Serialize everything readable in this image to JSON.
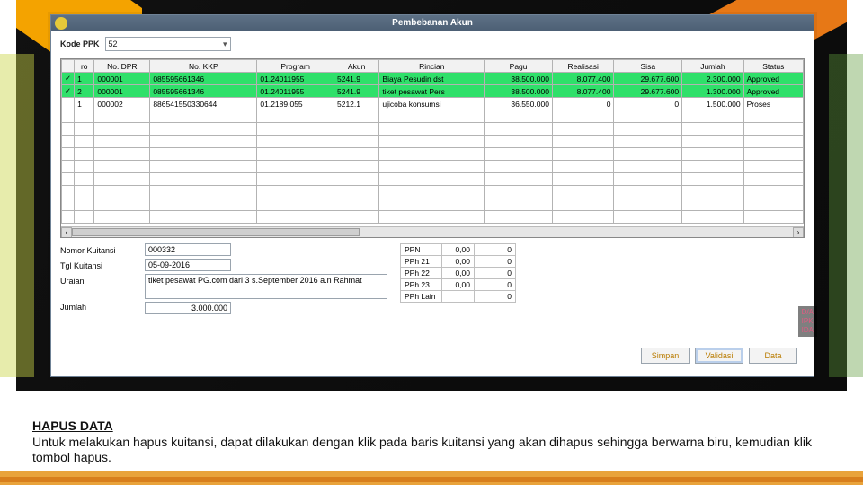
{
  "window": {
    "title": "Pembebanan Akun",
    "kode_ppk_label": "Kode PPK",
    "kode_ppk_value": "52"
  },
  "grid": {
    "headers": [
      "",
      "ro",
      "No. DPR",
      "No. KKP",
      "Program",
      "Akun",
      "Rincian",
      "Pagu",
      "Realisasi",
      "Sisa",
      "Jumlah",
      "Status"
    ],
    "rows": [
      {
        "hl": true,
        "cb": "✓",
        "ro": "1",
        "dpr": "000001",
        "kkp": "085595661346",
        "prog": "01.24011955",
        "akun": "5241.9",
        "rincian": "Biaya Pesudin dst",
        "pagu": "38.500.000",
        "real": "8.077.400",
        "sisa": "29.677.600",
        "jumlah": "2.300.000",
        "status": "Approved"
      },
      {
        "hl": true,
        "cb": "✓",
        "ro": "2",
        "dpr": "000001",
        "kkp": "085595661346",
        "prog": "01.24011955",
        "akun": "5241.9",
        "rincian": "tiket pesawat Pers",
        "pagu": "38.500.000",
        "real": "8.077.400",
        "sisa": "29.677.600",
        "jumlah": "1.300.000",
        "status": "Approved"
      },
      {
        "hl": false,
        "cb": "",
        "ro": "1",
        "dpr": "000002",
        "kkp": "886541550330644",
        "prog": "01.2189.055",
        "akun": "5212.1",
        "rincian": "ujicoba konsumsi",
        "pagu": "36.550.000",
        "real": "0",
        "sisa": "0",
        "jumlah": "1.500.000",
        "status": "Proses"
      }
    ],
    "empty_rows": 9
  },
  "detail": {
    "labels": {
      "nomor": "Nomor Kuitansi",
      "tgl": "Tgl Kuitansi",
      "uraian": "Uraian",
      "jumlah": "Jumlah"
    },
    "values": {
      "nomor": "000332",
      "tgl": "05-09-2016",
      "uraian": "tiket pesawat PG.com dari 3 s.September 2016 a.n Rahmat",
      "jumlah": "3.000.000"
    }
  },
  "taxes": {
    "rows": [
      {
        "name": "PPN",
        "pct": "0,00",
        "val": "0"
      },
      {
        "name": "PPh 21",
        "pct": "0,00",
        "val": "0"
      },
      {
        "name": "PPh 22",
        "pct": "0,00",
        "val": "0"
      },
      {
        "name": "PPh 23",
        "pct": "0,00",
        "val": "0"
      },
      {
        "name": "PPh Lain",
        "pct": "",
        "val": "0"
      }
    ]
  },
  "buttons": {
    "simpan": "Simpan",
    "validasi": "Validasi",
    "data": "Data"
  },
  "right_badges": [
    "D/A",
    "IPK",
    "IDA"
  ],
  "desc": {
    "heading": "HAPUS DATA",
    "body": "Untuk melakukan hapus kuitansi, dapat dilakukan dengan klik pada baris kuitansi yang akan dihapus sehingga berwarna biru, kemudian klik tombol hapus."
  }
}
